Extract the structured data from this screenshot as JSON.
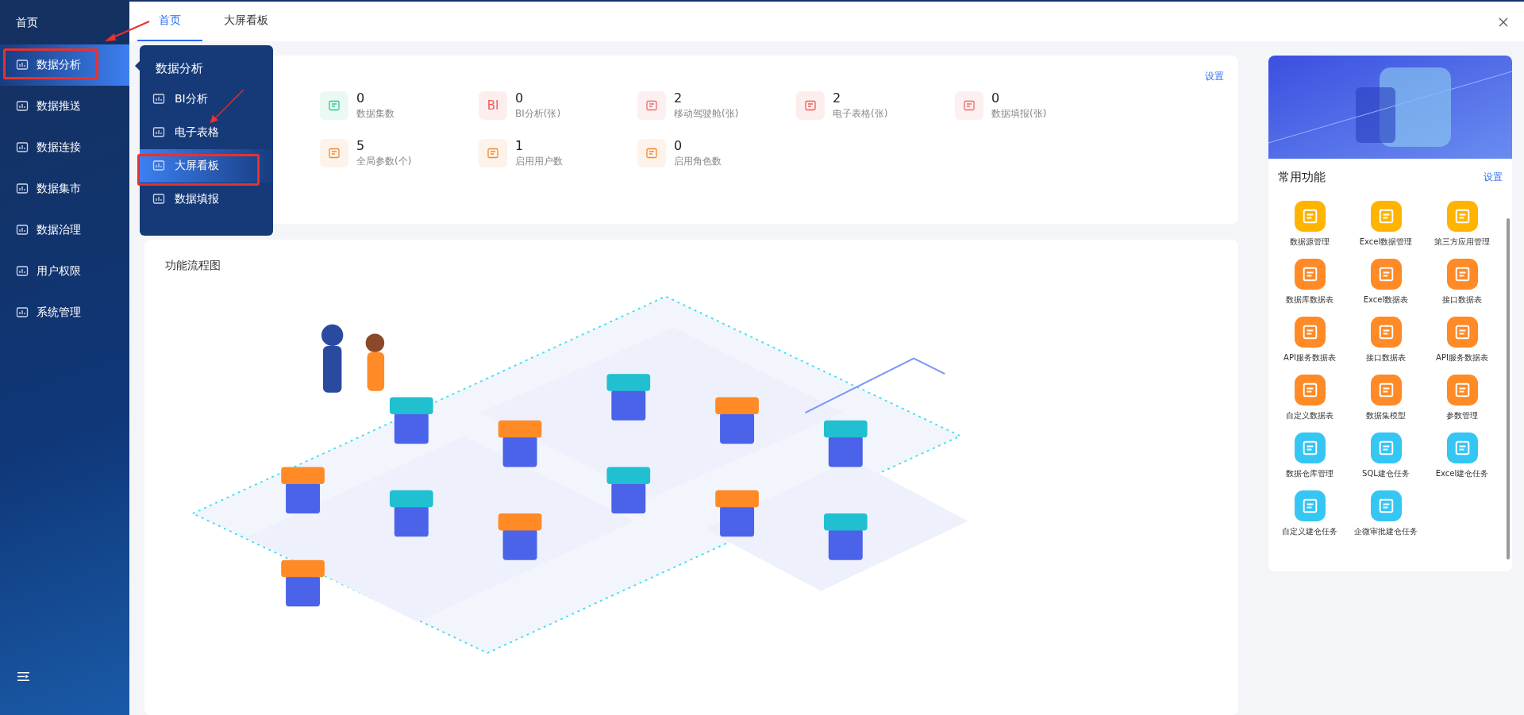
{
  "sidebar": {
    "home": "首页",
    "items": [
      {
        "label": "数据分析",
        "selected": true
      },
      {
        "label": "数据推送",
        "selected": false
      },
      {
        "label": "数据连接",
        "selected": false
      },
      {
        "label": "数据集市",
        "selected": false
      },
      {
        "label": "数据治理",
        "selected": false
      },
      {
        "label": "用户权限",
        "selected": false
      },
      {
        "label": "系统管理",
        "selected": false
      }
    ]
  },
  "submenu": {
    "title": "数据分析",
    "items": [
      {
        "label": "BI分析",
        "selected": false
      },
      {
        "label": "电子表格",
        "selected": false
      },
      {
        "label": "大屏看板",
        "selected": true
      },
      {
        "label": "数据填报",
        "selected": false
      }
    ]
  },
  "tabs": [
    {
      "label": "首页",
      "selected": true
    },
    {
      "label": "大屏看板",
      "selected": false
    }
  ],
  "stats": {
    "settings": "设置",
    "items": [
      {
        "value": "0",
        "label": "数据集数",
        "color": "#2ec98a"
      },
      {
        "value": "0",
        "label": "BI分析(张)",
        "color": "#f05a5a",
        "icon_text": "BI"
      },
      {
        "value": "2",
        "label": "移动驾驶舱(张)",
        "color": "#f06a6a"
      },
      {
        "value": "2",
        "label": "电子表格(张)",
        "color": "#f05a5a"
      },
      {
        "value": "0",
        "label": "数据填报(张)",
        "color": "#f06a6a"
      },
      {
        "value": "5",
        "label": "全局参数(个)",
        "color": "#f5892e"
      },
      {
        "value": "1",
        "label": "启用用户数",
        "color": "#f5892e"
      },
      {
        "value": "0",
        "label": "启用角色数",
        "color": "#f5892e"
      }
    ]
  },
  "flow": {
    "title": "功能流程图"
  },
  "quick": {
    "title": "常用功能",
    "settings": "设置",
    "items": [
      {
        "label": "数据源管理",
        "color": "#ffb400"
      },
      {
        "label": "Excel数据管理",
        "color": "#ffb400"
      },
      {
        "label": "第三方应用管理",
        "color": "#ffb400"
      },
      {
        "label": "数据库数据表",
        "color": "#ff8a26"
      },
      {
        "label": "Excel数据表",
        "color": "#ff8a26"
      },
      {
        "label": "接口数据表",
        "color": "#ff8a26"
      },
      {
        "label": "API服务数据表",
        "color": "#ff8a26"
      },
      {
        "label": "接口数据表",
        "color": "#ff8a26"
      },
      {
        "label": "API服务数据表",
        "color": "#ff8a26"
      },
      {
        "label": "自定义数据表",
        "color": "#ff8a26"
      },
      {
        "label": "数据集模型",
        "color": "#ff8a26"
      },
      {
        "label": "参数管理",
        "color": "#ff8a26"
      },
      {
        "label": "数据仓库管理",
        "color": "#35c6f4"
      },
      {
        "label": "SQL建仓任务",
        "color": "#35c6f4"
      },
      {
        "label": "Excel建仓任务",
        "color": "#35c6f4"
      },
      {
        "label": "自定义建仓任务",
        "color": "#35c6f4"
      },
      {
        "label": "企微审批建仓任务",
        "color": "#35c6f4"
      }
    ]
  }
}
